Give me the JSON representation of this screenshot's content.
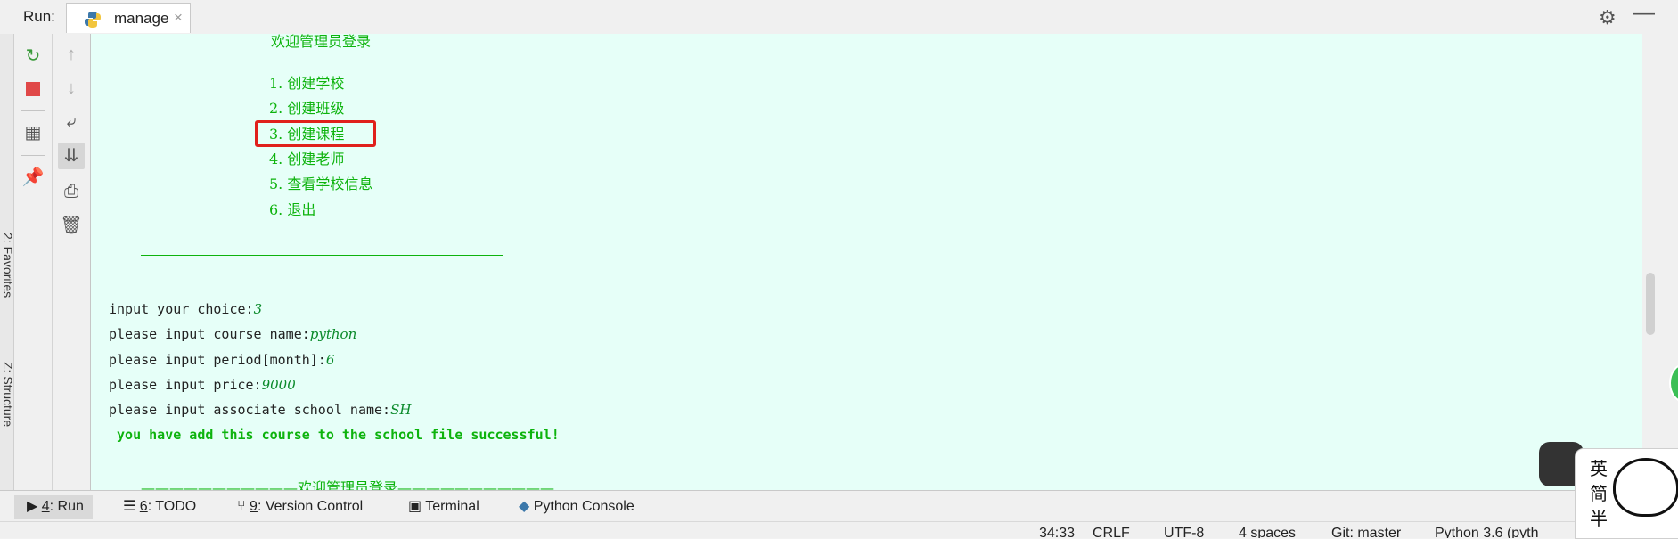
{
  "toolbar": {
    "run_label": "Run:",
    "tab_name": "manage",
    "close_glyph": "×",
    "settings_icon": "gear-icon",
    "minimize_glyph": "—"
  },
  "left_strip": {
    "favorites": "2: Favorites",
    "structure": "Z: Structure"
  },
  "console": {
    "partial_top": "欢迎管理员登录",
    "menu": [
      "1. 创建学校",
      "2. 创建班级",
      "3. 创建课程",
      "4. 创建老师",
      "5. 查看学校信息",
      "6. 退出"
    ],
    "separator": "==============================================",
    "prompts": [
      {
        "label": "input your choice:",
        "value": "3"
      },
      {
        "label": "please input course name:",
        "value": "python"
      },
      {
        "label": "please input period[month]:",
        "value": "6"
      },
      {
        "label": "please input price:",
        "value": "9000"
      },
      {
        "label": "please input associate school name:",
        "value": "SH"
      }
    ],
    "result": " you have add this course to the school file successful!",
    "next_banner": "———————————欢迎管理员登录———————————"
  },
  "bottom_tabs": [
    {
      "num": "4",
      "label": ": Run"
    },
    {
      "num": "6",
      "label": ": TODO"
    },
    {
      "num": "9",
      "label": ": Version Control"
    },
    {
      "num": "",
      "label": "Terminal"
    },
    {
      "num": "",
      "label": "Python Console"
    }
  ],
  "status": {
    "position": "34:33",
    "line_sep": "CRLF",
    "encoding": "UTF-8",
    "indent": "4 spaces",
    "git": "Git: master",
    "interpreter": "Python 3.6 (pyth"
  },
  "ime": {
    "text": "英简半"
  },
  "colors": {
    "console_bg": "#e6fff8",
    "output_green": "#0db30d",
    "highlight": "#e0201c"
  }
}
